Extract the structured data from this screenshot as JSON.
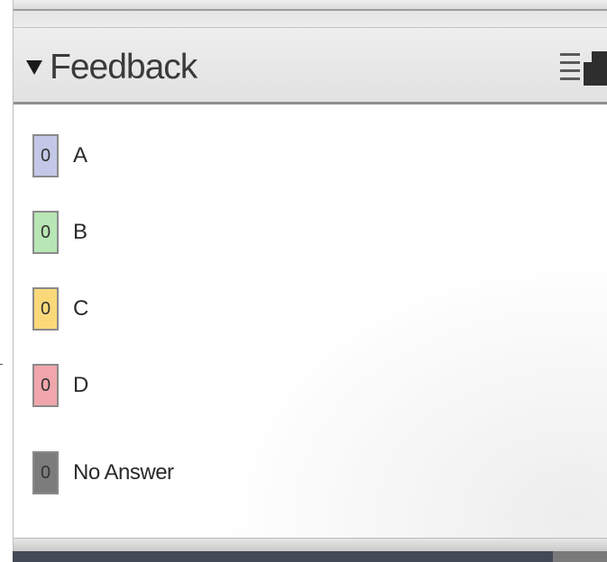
{
  "panel": {
    "title": "Feedback",
    "collapse_icon": "triangle-down-icon",
    "menu_icon": "list-menu-icon",
    "dock_icon": "dock-panel-icon"
  },
  "responses": [
    {
      "count": "0",
      "label": "A",
      "color": "#c3c8e8"
    },
    {
      "count": "0",
      "label": "B",
      "color": "#b8e6b4"
    },
    {
      "count": "0",
      "label": "C",
      "color": "#fbd97a"
    },
    {
      "count": "0",
      "label": "D",
      "color": "#f0a6ac"
    },
    {
      "count": "0",
      "label": "No Answer",
      "color": "#7c7c7c"
    }
  ]
}
